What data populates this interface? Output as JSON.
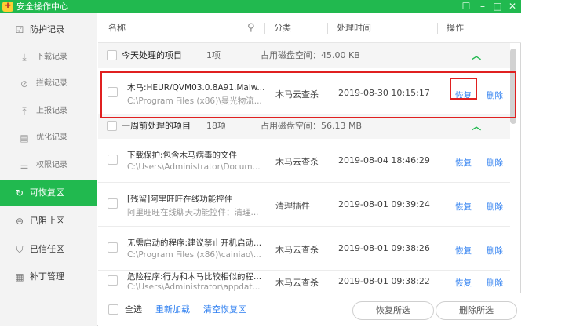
{
  "window": {
    "title": "安全操作中心"
  },
  "sidebar": {
    "items": [
      {
        "icon": "edit-icon",
        "glyph": "☑",
        "label": "防护记录",
        "sub": false,
        "active": false
      },
      {
        "icon": "download-icon",
        "glyph": "⤓",
        "label": "下载记录",
        "sub": true,
        "active": false
      },
      {
        "icon": "block-icon",
        "glyph": "⊘",
        "label": "拦截记录",
        "sub": true,
        "active": false
      },
      {
        "icon": "upload-icon",
        "glyph": "⤒",
        "label": "上报记录",
        "sub": true,
        "active": false
      },
      {
        "icon": "optimize-icon",
        "glyph": "▤",
        "label": "优化记录",
        "sub": true,
        "active": false
      },
      {
        "icon": "permission-icon",
        "glyph": "⚌",
        "label": "权限记录",
        "sub": true,
        "active": false
      },
      {
        "icon": "restore-icon",
        "glyph": "↻",
        "label": "可恢复区",
        "sub": false,
        "active": true
      },
      {
        "icon": "blocked-area-icon",
        "glyph": "⊖",
        "label": "已阻止区",
        "sub": false,
        "active": false
      },
      {
        "icon": "trusted-icon",
        "glyph": "⛉",
        "label": "已信任区",
        "sub": false,
        "active": false
      },
      {
        "icon": "patch-icon",
        "glyph": "▦",
        "label": "补丁管理",
        "sub": false,
        "active": false
      }
    ]
  },
  "header": {
    "name": "名称",
    "category": "分类",
    "time": "处理时间",
    "action": "操作"
  },
  "groups": [
    {
      "name": "今天处理的项目",
      "count": "1项",
      "disk": "占用磁盘空间：45.00 KB",
      "rows": [
        {
          "name": "木马:HEUR/QVM03.0.8A91.Malw...",
          "path": "C:\\Program Files (x86)\\曼光物流...",
          "category": "木马云查杀",
          "time": "2019-08-30 10:15:17"
        }
      ]
    },
    {
      "name": "一周前处理的项目",
      "count": "18项",
      "disk": "占用磁盘空间：56.13 MB",
      "rows": [
        {
          "name": "下载保护:包含木马病毒的文件",
          "path": "C:\\Users\\Administrator\\Docum...",
          "category": "木马云查杀",
          "time": "2019-08-04 18:46:29"
        },
        {
          "name": "[残留]阿里旺旺在线功能控件",
          "path": "阿里旺旺在线聊天功能控件：清理...",
          "category": "清理插件",
          "time": "2019-08-01 09:39:24"
        },
        {
          "name": "无需启动的程序:建议禁止开机启动...",
          "path": "C:\\Program Files (x86)\\cainiao\\...",
          "category": "木马云查杀",
          "time": "2019-08-01 09:38:26"
        },
        {
          "name": "危险程序:行为和木马比较相似的程...",
          "path": "C:\\Users\\Administrator\\appdat...",
          "category": "木马云查杀",
          "time": "2019-08-01 09:38:22"
        }
      ]
    }
  ],
  "row_actions": {
    "restore": "恢复",
    "delete": "删除"
  },
  "footer": {
    "select_all": "全选",
    "reload": "重新加载",
    "clear": "清空恢复区",
    "restore_selected": "恢复所选",
    "delete_selected": "删除所选"
  },
  "colors": {
    "accent": "#21b94f",
    "link": "#2c7ef0",
    "highlight": "#e02020"
  }
}
